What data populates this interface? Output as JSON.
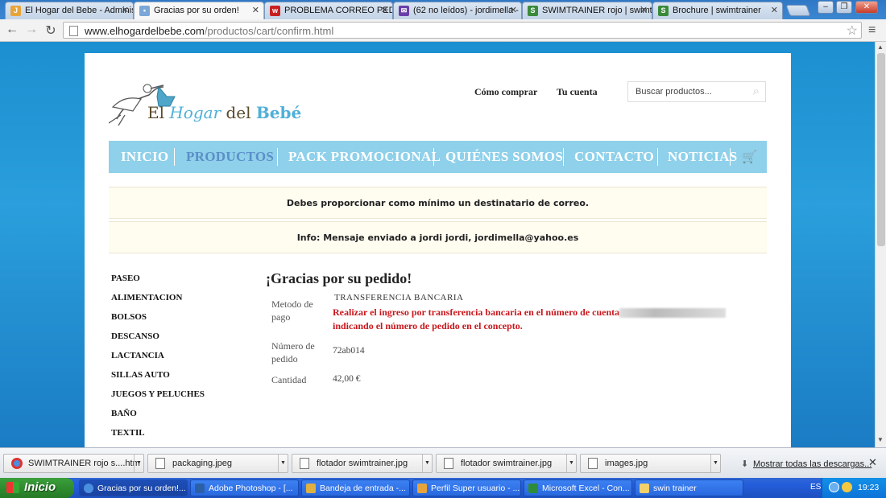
{
  "browser": {
    "tabs": [
      {
        "title": "El Hogar del Bebe - Administ",
        "favicon_color": "#e8a43a",
        "active": false
      },
      {
        "title": "Gracias por su orden!",
        "favicon_color": "#7aa7d8",
        "active": true
      },
      {
        "title": "PROBLEMA CORREO PEDID",
        "favicon_color": "#c82020",
        "active": false
      },
      {
        "title": "(62 no leídos) - jordimella - ",
        "favicon_color": "#6a3ea8",
        "active": false
      },
      {
        "title": "SWIMTRAINER rojo | swimt",
        "favicon_color": "#3a8a3a",
        "active": false
      },
      {
        "title": "Brochure | swimtrainer",
        "favicon_color": "#3a8a3a",
        "active": false
      }
    ],
    "url_host": "www.elhogardelbebe.com",
    "url_path": "/productos/cart/confirm.html"
  },
  "site": {
    "logo": {
      "word1": "El",
      "word2": "Hogar",
      "word3": "del",
      "word4": "Bebé"
    },
    "top_links": {
      "how_to_buy": "Cómo comprar",
      "account": "Tu cuenta"
    },
    "search_placeholder": "Buscar productos...",
    "nav": [
      "INICIO",
      "PRODUCTOS",
      "PACK PROMOCIONAL",
      "QUIÉNES SOMOS",
      "CONTACTO",
      "NOTICIAS"
    ],
    "current_nav": "PRODUCTOS",
    "notices": [
      "Debes proporcionar como mínimo un destinatario de correo.",
      "Info: Mensaje enviado a jordi jordi, jordimella@yahoo.es"
    ],
    "categories": [
      "PASEO",
      "ALIMENTACION",
      "BOLSOS",
      "DESCANSO",
      "LACTANCIA",
      "SILLAS AUTO",
      "JUEGOS Y PELUCHES",
      "BAÑO",
      "TEXTIL"
    ],
    "order": {
      "heading": "¡Gracias por su pedido!",
      "payment_label": "Metodo de pago",
      "payment_method": "TRANSFERENCIA BANCARIA",
      "payment_instruction_1": "Realizar el ingreso por transferencia bancaria en el número de cuenta",
      "payment_instruction_2": "indicando el número de pedido en el concepto.",
      "order_number_label": "Número de pedido",
      "order_number": "72ab014",
      "quantity_label": "Cantidad",
      "quantity": "42,00 €"
    },
    "accent_color": "#8fd0ea",
    "alert_color": "#c8181d"
  },
  "downloads": {
    "items": [
      {
        "name": "SWIMTRAINER rojo   s....htm",
        "type": "chrome"
      },
      {
        "name": "packaging.jpeg",
        "type": "image"
      },
      {
        "name": "flotador swimtrainer.jpg",
        "type": "image"
      },
      {
        "name": "flotador swimtrainer.jpg",
        "type": "image"
      },
      {
        "name": "images.jpg",
        "type": "image"
      }
    ],
    "show_all": "Mostrar todas las descargas..."
  },
  "taskbar": {
    "start": "Inicio",
    "tasks": [
      {
        "title": "Gracias por su orden!...",
        "active": true
      },
      {
        "title": "Adobe Photoshop - [...",
        "active": false
      },
      {
        "title": "Bandeja de entrada -...",
        "active": false
      },
      {
        "title": "Perfil Super usuario - ...",
        "active": false
      },
      {
        "title": "Microsoft Excel - Con...",
        "active": false
      },
      {
        "title": "swin trainer",
        "active": false
      }
    ],
    "language": "ES",
    "time": "19:23"
  }
}
